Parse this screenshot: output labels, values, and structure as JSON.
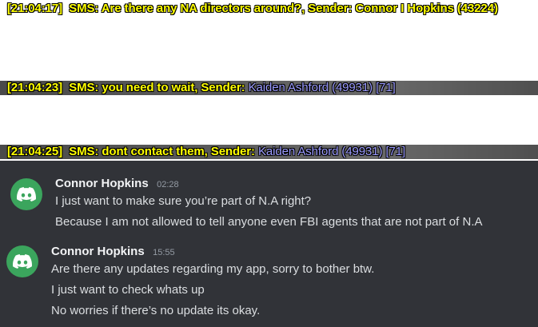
{
  "sms_log": [
    {
      "timestamp": "[21:04:17]",
      "text": "SMS: Are there any NA directors around?, Sender: Connor I Hopkins (43224)",
      "sender": ""
    },
    {
      "timestamp": "[21:04:23]",
      "text": "SMS: you need to wait, Sender:",
      "sender": "Kaiden Ashford (49931) [71]"
    },
    {
      "timestamp": "[21:04:25]",
      "text": "SMS: dont contact them, Sender:",
      "sender": "Kaiden Ashford (49931) [71]"
    }
  ],
  "messages": [
    {
      "author": "Connor Hopkins",
      "time": "02:28",
      "avatar_icon": "discord-logo-icon",
      "avatar_color": "#3ba55d",
      "lines": [
        "I just want to make sure you’re part of N.A right?",
        "Because I am not allowed to tell anyone even FBI agents that are not part of N.A"
      ]
    },
    {
      "author": "Connor Hopkins",
      "time": "15:55",
      "avatar_icon": "discord-logo-icon",
      "avatar_color": "#3ba55d",
      "lines": [
        "Are there any updates regarding my app, sorry to bother btw.",
        "I just want to check whats up",
        "No worries if there’s no update its okay."
      ]
    }
  ]
}
